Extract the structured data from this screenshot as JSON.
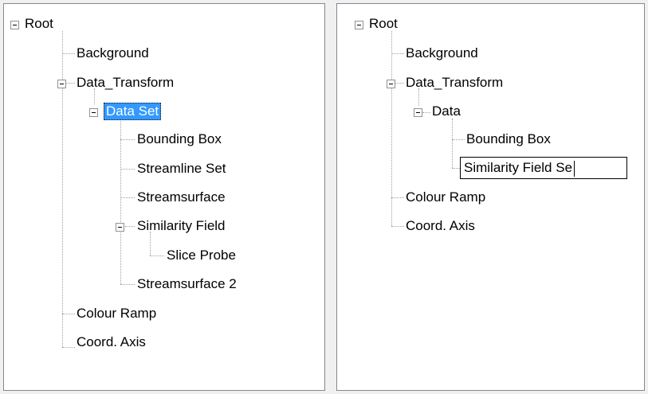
{
  "left_tree": {
    "root": "Root",
    "background": "Background",
    "data_transform": "Data_Transform",
    "data_set": "Data Set",
    "bounding_box": "Bounding Box",
    "streamline_set": "Streamline Set",
    "streamsurface": "Streamsurface",
    "similarity_field": "Similarity Field",
    "slice_probe": "Slice Probe",
    "streamsurface_2": "Streamsurface 2",
    "colour_ramp": "Colour Ramp",
    "coord_axis": "Coord. Axis",
    "selected_node": "Data Set"
  },
  "right_tree": {
    "root": "Root",
    "background": "Background",
    "data_transform": "Data_Transform",
    "data": "Data",
    "bounding_box": "Bounding Box",
    "edit_value": "Similarity Field Se",
    "colour_ramp": "Colour Ramp",
    "coord_axis": "Coord. Axis"
  },
  "colors": {
    "selection": "#3399ff",
    "panel_border": "#828790",
    "connector": "#a0a0a0"
  }
}
